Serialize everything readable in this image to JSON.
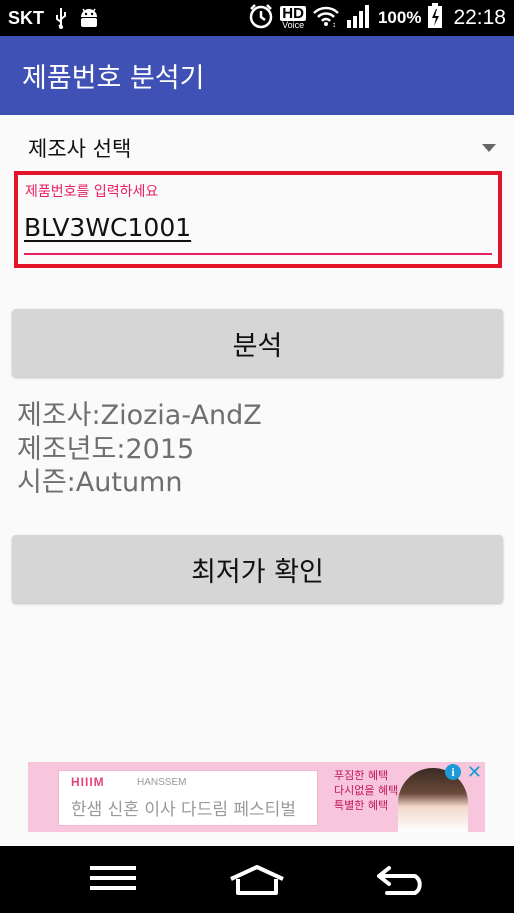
{
  "status_bar": {
    "carrier": "SKT",
    "battery_percent": "100%",
    "time": "22:18",
    "icons": [
      "usb-icon",
      "android-debug-icon",
      "alarm-icon",
      "hd-voice-icon",
      "wifi-icon",
      "signal-icon",
      "battery-charging-icon"
    ],
    "hd_label": "HD",
    "voice_label": "Voice"
  },
  "app_bar": {
    "title": "제품번호 분석기",
    "color": "#3f51b5"
  },
  "form": {
    "manufacturer_spinner": "제조사 선택",
    "product_number_hint": "제품번호를 입력하세요",
    "product_number_value": "BLV3WC1001",
    "highlight_color": "#e3132b",
    "accent_color": "#e91e63"
  },
  "buttons": {
    "analyze": "분석",
    "lowest_price": "최저가 확인"
  },
  "results": {
    "manufacturer": "제조사:Ziozia-AndZ",
    "year": "제조년도:2015",
    "season": "시즌:Autumn"
  },
  "ad": {
    "logo": "HIIIM",
    "brand": "HANSSEM",
    "headline": "한샘 신혼 이사 다드림 페스티벌",
    "benefit_1": "푸짐한 혜택",
    "benefit_2": "다시없을 혜택",
    "benefit_3": "특별한 혜택",
    "info_icon": "i",
    "close_icon": "✕"
  },
  "nav_bar": {
    "icons": [
      "menu-icon",
      "home-icon",
      "back-icon"
    ]
  }
}
